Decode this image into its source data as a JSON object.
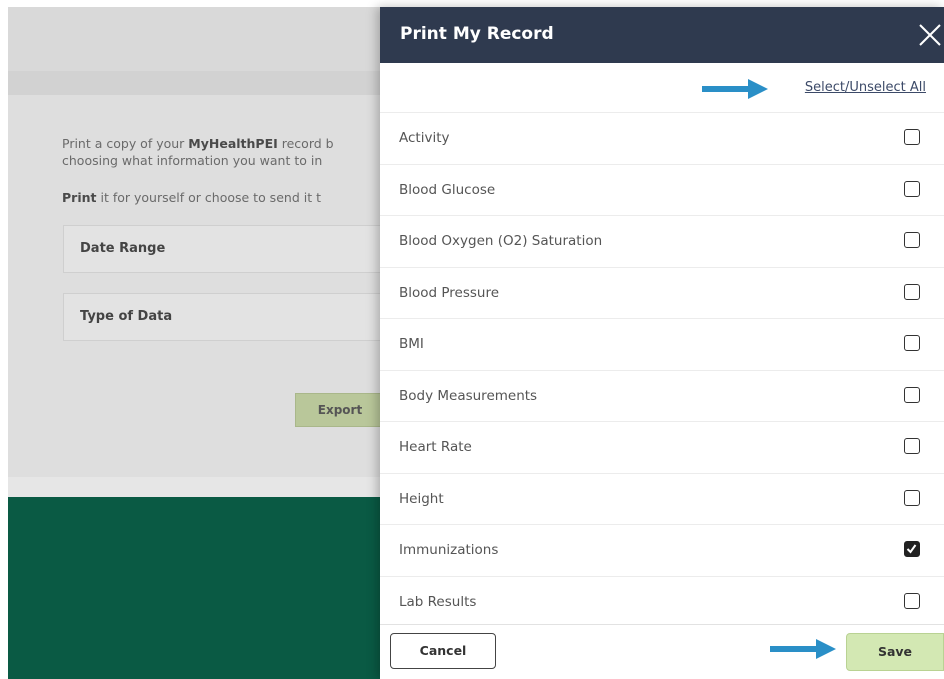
{
  "background": {
    "intro_prefix": "Print a copy of your ",
    "intro_bold": "MyHealthPEI",
    "intro_suffix": " record b",
    "intro_line2": "choosing what information you want to in",
    "print_bold": "Print",
    "print_rest": " it for yourself or choose to send it t",
    "date_range_label": "Date Range",
    "type_of_data_label": "Type of Data",
    "export_label": "Export"
  },
  "modal": {
    "title": "Print My Record",
    "select_all_label": "Select/Unselect All",
    "items": [
      {
        "label": "Activity",
        "checked": false
      },
      {
        "label": "Blood Glucose",
        "checked": false
      },
      {
        "label": "Blood Oxygen (O2) Saturation",
        "checked": false
      },
      {
        "label": "Blood Pressure",
        "checked": false
      },
      {
        "label": "BMI",
        "checked": false
      },
      {
        "label": "Body Measurements",
        "checked": false
      },
      {
        "label": "Heart Rate",
        "checked": false
      },
      {
        "label": "Height",
        "checked": false
      },
      {
        "label": "Immunizations",
        "checked": true
      },
      {
        "label": "Lab Results",
        "checked": false
      }
    ],
    "cancel_label": "Cancel",
    "save_label": "Save"
  },
  "colors": {
    "header": "#2f3a4f",
    "footer_green": "#0a5a44",
    "arrow_blue": "#2a8fc7",
    "save_green": "#d3e8b3"
  },
  "icons": [
    "close-icon",
    "arrow-right-icon",
    "checkmark-icon"
  ]
}
